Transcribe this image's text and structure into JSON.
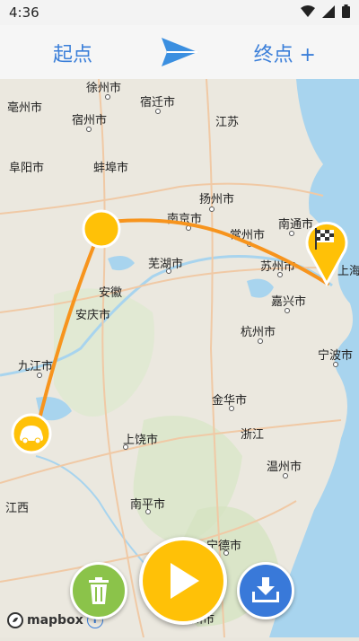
{
  "status_bar": {
    "time": "4:36",
    "icons": [
      "wifi-icon",
      "signal-icon",
      "battery-icon"
    ]
  },
  "topbar": {
    "start_label": "起点",
    "end_label": "终点 +"
  },
  "map": {
    "cities": [
      {
        "name": "亳州市"
      },
      {
        "name": "徐州市"
      },
      {
        "name": "宿迁市"
      },
      {
        "name": "宿州市"
      },
      {
        "name": "江苏"
      },
      {
        "name": "阜阳市"
      },
      {
        "name": "蚌埠市"
      },
      {
        "name": "扬州市"
      },
      {
        "name": "南京市"
      },
      {
        "name": "南通市"
      },
      {
        "name": "常州市"
      },
      {
        "name": "芜湖市"
      },
      {
        "name": "苏州市"
      },
      {
        "name": "上海"
      },
      {
        "name": "安徽"
      },
      {
        "name": "嘉兴市"
      },
      {
        "name": "安庆市"
      },
      {
        "name": "杭州市"
      },
      {
        "name": "宁波市"
      },
      {
        "name": "九江市"
      },
      {
        "name": "金华市"
      },
      {
        "name": "浙江"
      },
      {
        "name": "上饶市"
      },
      {
        "name": "温州市"
      },
      {
        "name": "江西"
      },
      {
        "name": "南平市"
      },
      {
        "name": "宁德市"
      },
      {
        "name": "福州市"
      }
    ]
  },
  "attribution": {
    "brand": "mapbox",
    "info_symbol": "i"
  },
  "colors": {
    "accent": "#3b7fd9",
    "route": "#f7941d",
    "marker": "#ffc107",
    "trash": "#8bc34a",
    "download": "#3979d9"
  }
}
